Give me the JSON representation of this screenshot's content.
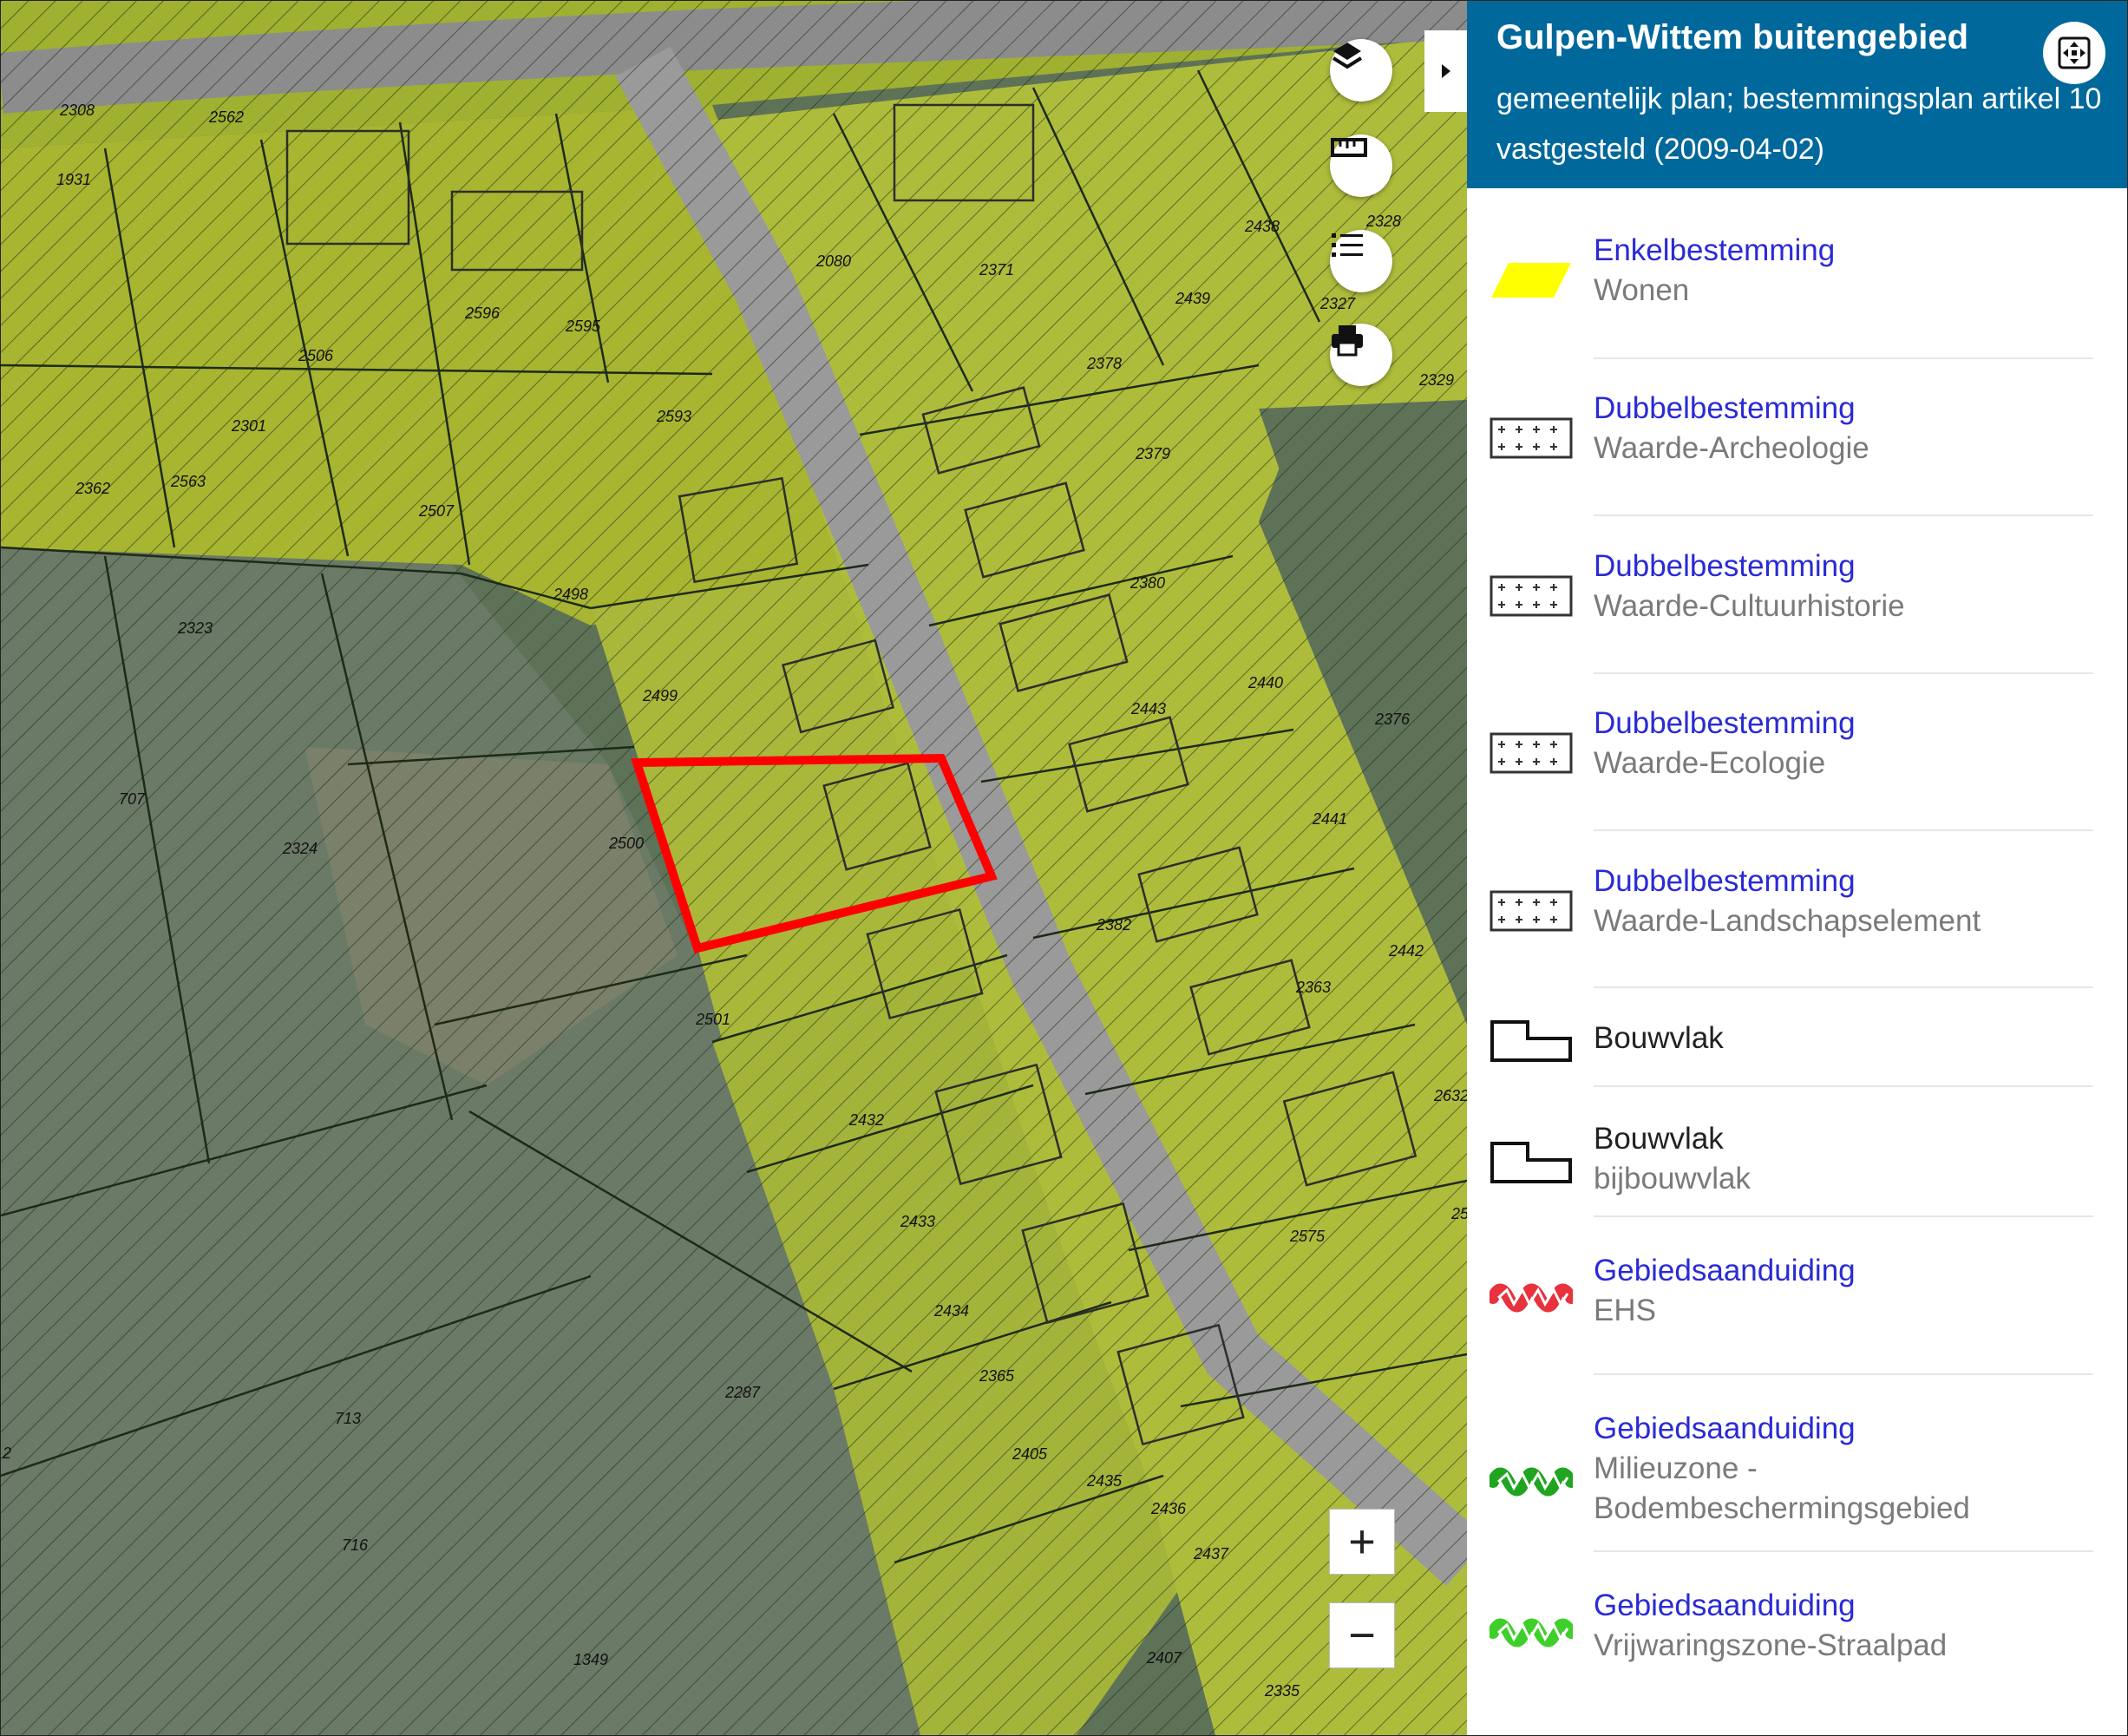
{
  "map": {
    "parcel_labels": [
      "2308",
      "2562",
      "1931",
      "2596",
      "2595",
      "2506",
      "2301",
      "2593",
      "2507",
      "2362",
      "2563",
      "2498",
      "2323",
      "2499",
      "707",
      "2324",
      "2500",
      "2501",
      "2080",
      "2371",
      "2438",
      "2439",
      "2327",
      "2329",
      "2378",
      "2379",
      "2380",
      "2440",
      "2443",
      "2376",
      "2441",
      "2382",
      "2442",
      "2363",
      "2432",
      "2433",
      "2434",
      "2365",
      "2405",
      "2435",
      "2436",
      "2437",
      "2407",
      "2335",
      "2575",
      "2287",
      "713",
      "716",
      "1349",
      "2632",
      "2328",
      "25",
      "2"
    ],
    "highlight_color": "#ff0000",
    "zoom_in_label": "+",
    "zoom_out_label": "−"
  },
  "controls": {
    "layers_icon": "layers-icon",
    "measure_icon": "ruler-icon",
    "legend_icon": "list-icon",
    "print_icon": "printer-icon",
    "collapse_icon": "triangle-right-icon",
    "fit_icon": "fit-extent-icon"
  },
  "panel": {
    "title": "Gulpen-Wittem buitengebied",
    "subtitle_line1": "gemeentelijk plan; bestemmingsplan artikel 10",
    "subtitle_line2": "vastgesteld (2009-04-02)",
    "header_color": "#01689b",
    "legend": [
      {
        "symbol": "yellow-parallelogram",
        "title": "Enkelbestemming",
        "subtitle": "Wonen"
      },
      {
        "symbol": "cross-grid-box",
        "title": "Dubbelbestemming",
        "subtitle": "Waarde-Archeologie"
      },
      {
        "symbol": "cross-grid-box",
        "title": "Dubbelbestemming",
        "subtitle": "Waarde-Cultuurhistorie"
      },
      {
        "symbol": "cross-grid-box",
        "title": "Dubbelbestemming",
        "subtitle": "Waarde-Ecologie"
      },
      {
        "symbol": "cross-grid-box",
        "title": "Dubbelbestemming",
        "subtitle": "Waarde-Landschapselement"
      },
      {
        "symbol": "building-outline",
        "title": "Bouwvlak",
        "subtitle": ""
      },
      {
        "symbol": "building-outline",
        "title": "Bouwvlak",
        "subtitle": "bijbouwvlak"
      },
      {
        "symbol": "red-zigzag",
        "title": "Gebiedsaanduiding",
        "subtitle": "EHS"
      },
      {
        "symbol": "green-zigzag",
        "title": "Gebiedsaanduiding",
        "subtitle": "Milieuzone -",
        "subtitle2": "Bodembeschermingsgebied"
      },
      {
        "symbol": "green-zigzag",
        "title": "Gebiedsaanduiding",
        "subtitle": "Vrijwaringszone-Straalpad"
      }
    ]
  }
}
